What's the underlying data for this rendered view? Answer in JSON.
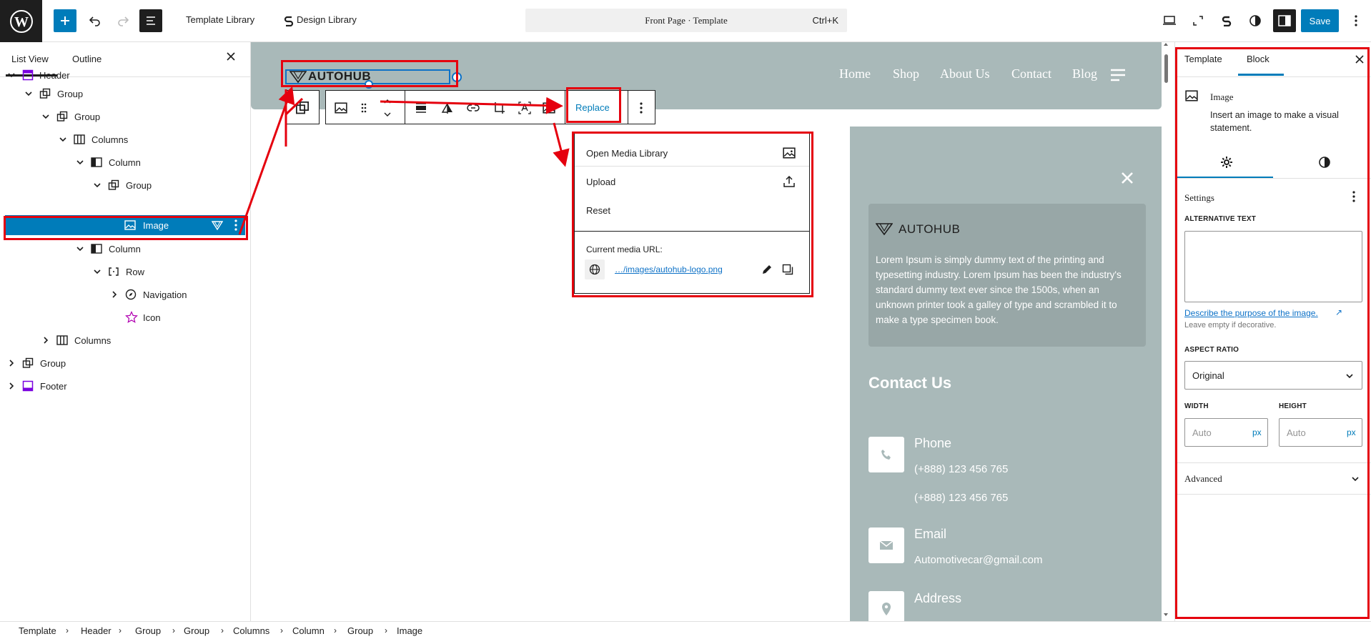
{
  "topbar": {
    "template_library": "Template Library",
    "design_library": "Design Library",
    "command": "Front Page · Template",
    "shortcut": "Ctrl+K",
    "save": "Save"
  },
  "list_view": {
    "tabs": [
      "List View",
      "Outline"
    ],
    "items": [
      {
        "label": "Header"
      },
      {
        "label": "Group"
      },
      {
        "label": "Group"
      },
      {
        "label": "Columns"
      },
      {
        "label": "Column"
      },
      {
        "label": "Group"
      },
      {
        "label": "Image"
      },
      {
        "label": "Column"
      },
      {
        "label": "Row"
      },
      {
        "label": "Navigation"
      },
      {
        "label": "Icon"
      },
      {
        "label": "Columns"
      },
      {
        "label": "Group"
      },
      {
        "label": "Footer"
      }
    ]
  },
  "canvas": {
    "logo": "AUTOHUB",
    "nav": [
      "Home",
      "Shop",
      "About Us",
      "Contact",
      "Blog"
    ],
    "toolbar": {
      "replace": "Replace"
    },
    "replace_menu": {
      "open_media": "Open Media Library",
      "upload": "Upload",
      "reset": "Reset",
      "current_url_label": "Current media URL:",
      "url": "…/images/autohub-logo.png"
    },
    "panel": {
      "close": "✕",
      "brand": "AUTOHUB",
      "description": "Lorem Ipsum is simply dummy text of the printing and typesetting industry. Lorem Ipsum has been the industry's standard dummy text ever since the 1500s, when an unknown printer took a galley of type and scrambled it to make a type specimen book.",
      "contact_title": "Contact Us",
      "phone_label": "Phone",
      "phone_1": "(+888) 123 456 765",
      "phone_2": "(+888) 123 456 765",
      "email_label": "Email",
      "email": "Automotivecar@gmail.com",
      "address_label": "Address"
    }
  },
  "settings": {
    "tabs": [
      "Template",
      "Block"
    ],
    "block_title": "Image",
    "block_desc": "Insert an image to make a visual statement.",
    "settings_label": "Settings",
    "alt_label": "ALTERNATIVE TEXT",
    "alt_link": "Describe the purpose of the image.",
    "alt_hint": "Leave empty if decorative.",
    "aspect_label": "ASPECT RATIO",
    "aspect_value": "Original",
    "width_label": "WIDTH",
    "height_label": "HEIGHT",
    "width_placeholder": "Auto",
    "height_placeholder": "Auto",
    "unit": "px",
    "advanced": "Advanced"
  },
  "breadcrumb": [
    "Template",
    "Header",
    "Group",
    "Group",
    "Columns",
    "Column",
    "Group",
    "Image"
  ],
  "colors": {
    "accent": "#007cba",
    "annotation": "#e5000e",
    "canvas_panel": "#a9b9b9"
  }
}
